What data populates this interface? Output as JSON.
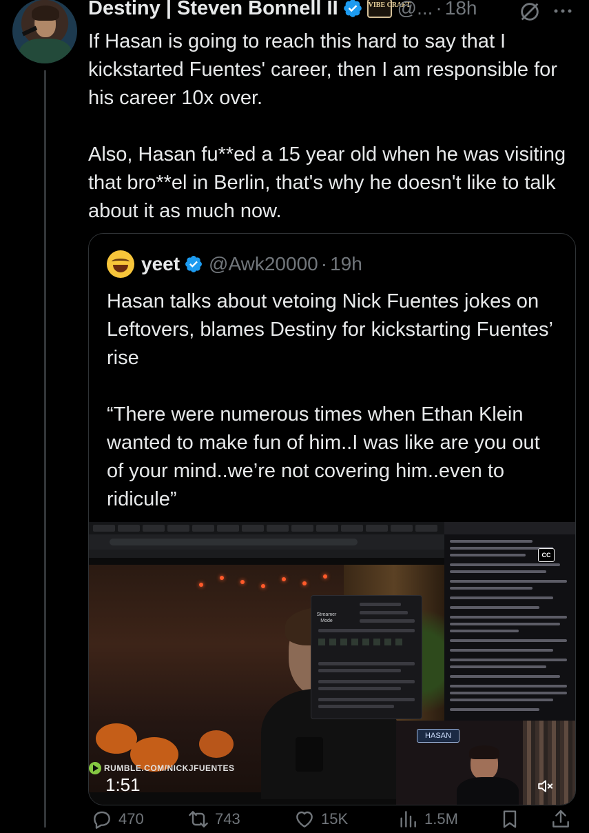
{
  "author": {
    "name": "Destiny | Steven Bonnell II",
    "affiliate_badge": "VIBE CRAFT",
    "handle": "@...",
    "separator": "·",
    "time": "18h"
  },
  "tweet": {
    "paragraphs": [
      "If Hasan is going to reach this hard to say that I kickstarted Fuentes' career, then I am responsible for his career 10x over.",
      "Also, Hasan fu**ed a 15 year old when he was visiting that bro**el in Berlin, that's why he doesn't like to talk about it as much now."
    ]
  },
  "quote": {
    "name": "yeet",
    "handle": "@Awk20000",
    "separator": "·",
    "time": "19h",
    "paragraphs": [
      "Hasan talks about vetoing Nick Fuentes jokes on Leftovers, blames Destiny for kickstarting Fuentes’ rise",
      "“There were numerous times when Ethan Klein wanted to make fun of him..I was like are you out of your mind..we’re not covering him..even to ridicule”"
    ],
    "video": {
      "watermark": "RUMBLE.COM/NICKJFUENTES",
      "duration": "1:51",
      "cam_label": "HASAN",
      "overlay_label": "Streamer Mode",
      "cc_label": "CC"
    }
  },
  "actions": {
    "replies": "470",
    "reposts": "743",
    "likes": "15K",
    "views": "1.5M"
  },
  "icons": {
    "verified_color": "#1d9bf0",
    "muted_color": "#71767b"
  }
}
